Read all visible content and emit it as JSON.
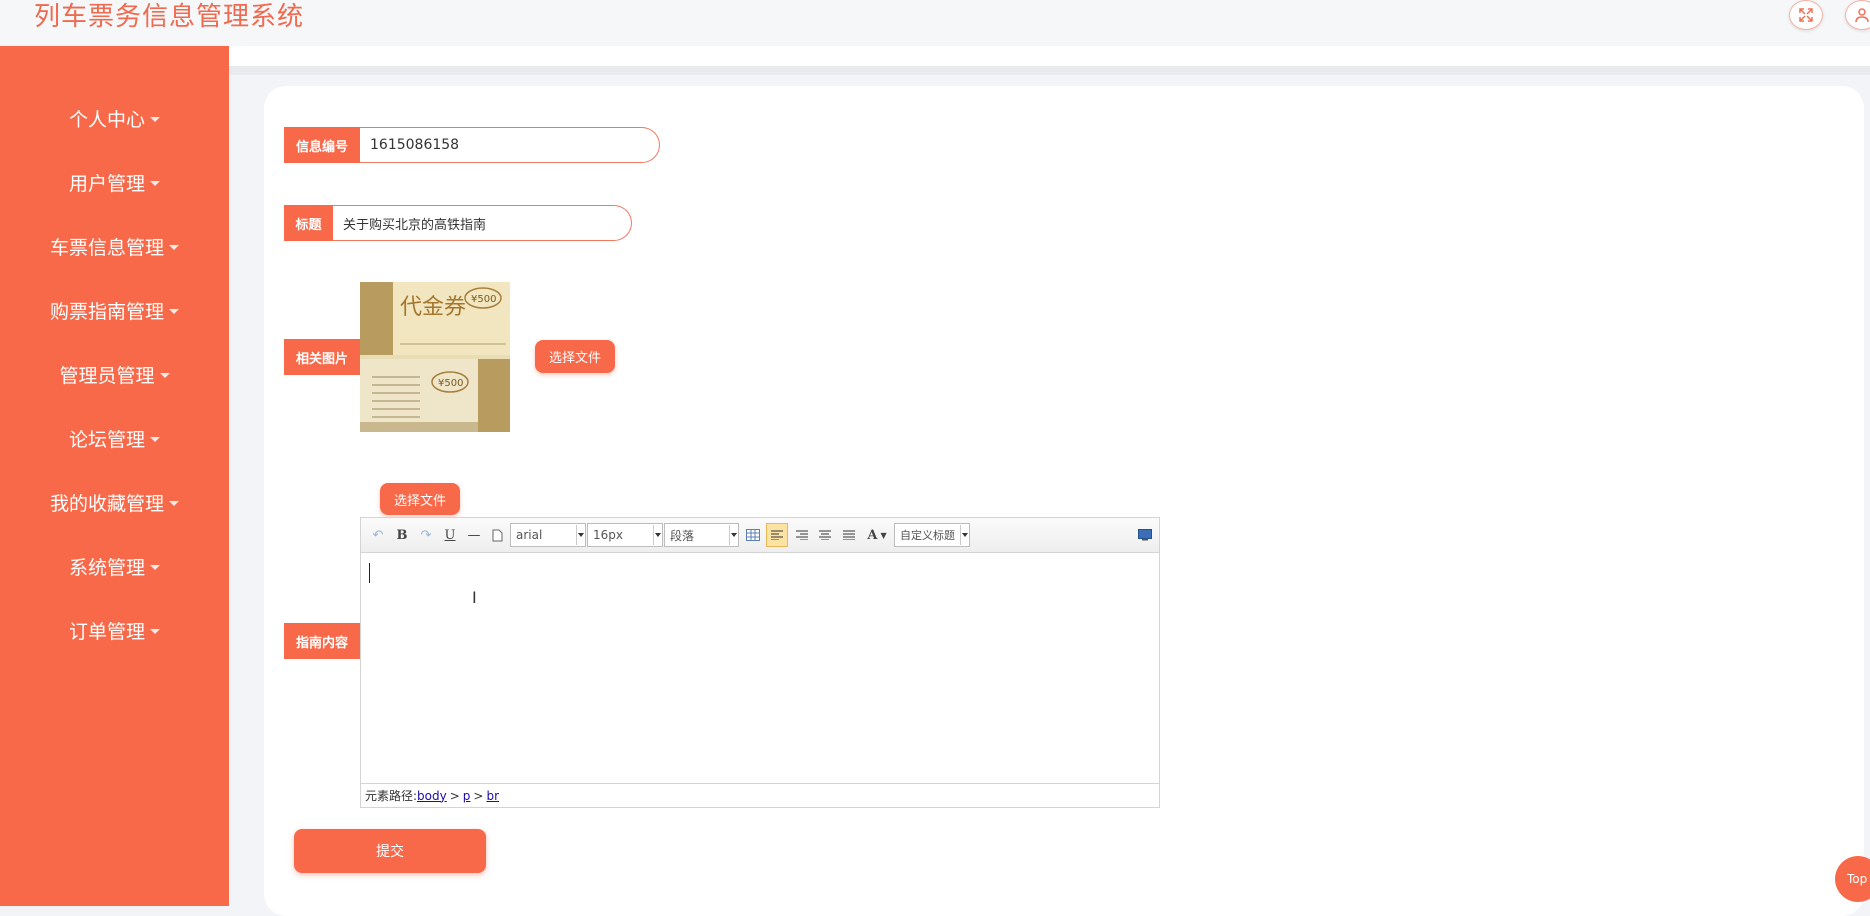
{
  "app": {
    "title": "列车票务信息管理系统"
  },
  "header": {
    "icons": [
      "fullscreen-icon",
      "user-icon"
    ]
  },
  "sidebar": {
    "items": [
      {
        "label": "个人中心"
      },
      {
        "label": "用户管理"
      },
      {
        "label": "车票信息管理"
      },
      {
        "label": "购票指南管理"
      },
      {
        "label": "管理员管理"
      },
      {
        "label": "论坛管理"
      },
      {
        "label": "我的收藏管理"
      },
      {
        "label": "系统管理"
      },
      {
        "label": "订单管理"
      }
    ]
  },
  "form": {
    "info_no": {
      "label": "信息编号",
      "value": "1615086158"
    },
    "title": {
      "label": "标题",
      "value": "关于购买北京的高铁指南"
    },
    "image": {
      "label": "相关图片",
      "choose_label": "选择文件",
      "alt": "代金券"
    },
    "content": {
      "label": "指南内容",
      "choose_label": "选择文件",
      "toolbar": {
        "font_family": "arial",
        "font_size": "16px",
        "paragraph": "段落",
        "custom_title": "自定义标题"
      },
      "path": {
        "prefix": "元素路径:",
        "parts": [
          "body",
          "p",
          "br"
        ],
        "sep": ">"
      }
    },
    "submit_label": "提交"
  },
  "back_to_top": "Top",
  "colors": {
    "accent": "#f8694a",
    "title": "#ef6a4f"
  }
}
